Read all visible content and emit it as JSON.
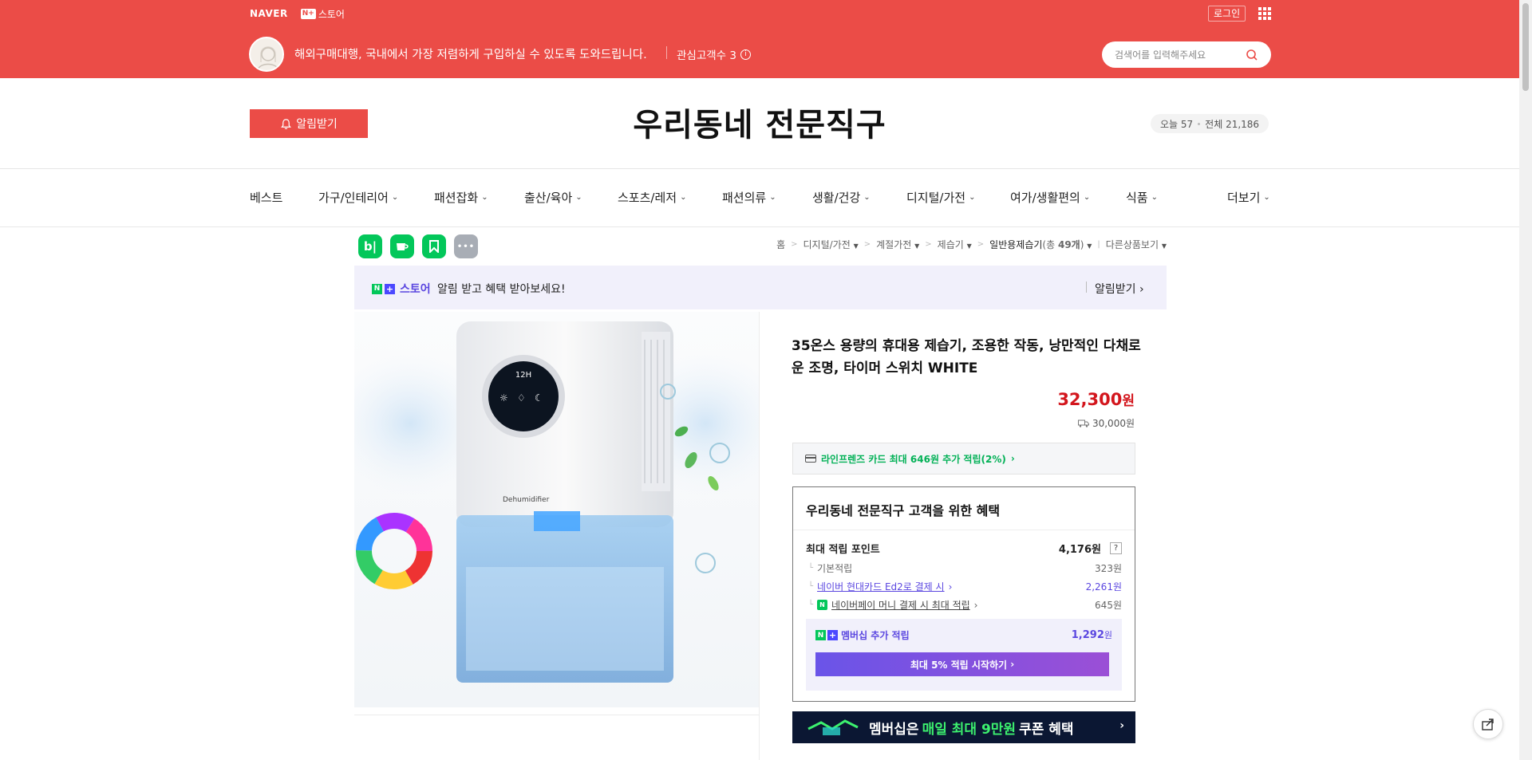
{
  "gnb": {
    "naver": "NAVER",
    "nplus_mark": "N+",
    "store_label": "스토어",
    "login": "로그인"
  },
  "store": {
    "description": "해외구매대행, 국내에서 가장 저렴하게 구입하실 수 있도록 도와드립니다.",
    "fans_label": "관심고객수 3",
    "search_placeholder": "검색어를 입력해주세요",
    "alarm_button": "알림받기",
    "name": "우리동네 전문직구",
    "visitors_today": "오늘 57",
    "visitors_total": "전체 21,186"
  },
  "categories": [
    {
      "label": "베스트",
      "has_menu": false
    },
    {
      "label": "가구/인테리어",
      "has_menu": true
    },
    {
      "label": "패션잡화",
      "has_menu": true
    },
    {
      "label": "출산/육아",
      "has_menu": true
    },
    {
      "label": "스포츠/레저",
      "has_menu": true
    },
    {
      "label": "패션의류",
      "has_menu": true
    },
    {
      "label": "생활/건강",
      "has_menu": true
    },
    {
      "label": "디지털/가전",
      "has_menu": true
    },
    {
      "label": "여가/생활편의",
      "has_menu": true
    },
    {
      "label": "식품",
      "has_menu": true
    },
    {
      "label": "더보기",
      "has_menu": true
    }
  ],
  "share_icons": [
    {
      "name": "blog-icon",
      "glyph": "b|",
      "color": "#03c75a"
    },
    {
      "name": "cafe-icon",
      "glyph": "☕",
      "color": "#03c75a"
    },
    {
      "name": "bookmark-icon",
      "glyph": "⚑",
      "color": "#03c75a"
    },
    {
      "name": "more-icon",
      "glyph": "•••",
      "color": "#a8adb5"
    }
  ],
  "breadcrumb": {
    "home": "홈",
    "level1": "디지털/가전",
    "level2": "계절가전",
    "level3": "제습기",
    "level4": "일반용제습기",
    "count_prefix": "(총 ",
    "count": "49개",
    "count_suffix": ")",
    "other": "다른상품보기"
  },
  "member_banner": {
    "store": "스토어",
    "message": "알림 받고 혜택 받아보세요!",
    "action": "알림받기"
  },
  "product": {
    "image_text": {
      "timer": "12H",
      "brand": "Dehumidifier"
    },
    "title": "35온스 용량의 휴대용 제습기, 조용한 작동, 낭만적인 다채로운 조명, 타이머 스위치 WHITE",
    "price": "32,300",
    "currency": "원",
    "shipping": "30,000원",
    "card_benefit": "라인프렌즈 카드 최대 646원 추가 적립(2%)"
  },
  "benefit": {
    "heading": "우리동네 전문직구 고객을 위한 혜택",
    "max_points_label": "최대 적립 포인트",
    "max_points_value": "4,176원",
    "help": "?",
    "rows": [
      {
        "label": "기본적립",
        "value": "323원"
      },
      {
        "label": "네이버 현대카드 Ed2로 결제 시",
        "value": "2,261원"
      },
      {
        "label": "네이버페이 머니 결제 시 최대 적립",
        "value": "645원"
      }
    ],
    "membership_label": "멤버십 추가 적립",
    "membership_value": "1,292",
    "membership_unit": "원",
    "start_button": "최대 5% 적립 시작하기"
  },
  "promo": {
    "prefix": "멤버십은",
    "highlight": "매일 최대 9만원",
    "suffix": "쿠폰 혜택"
  },
  "colors": {
    "brand_red": "#eb4c47",
    "price_red": "#d3161d",
    "naver_green": "#03c75a",
    "membership_purple": "#5b47e0"
  }
}
